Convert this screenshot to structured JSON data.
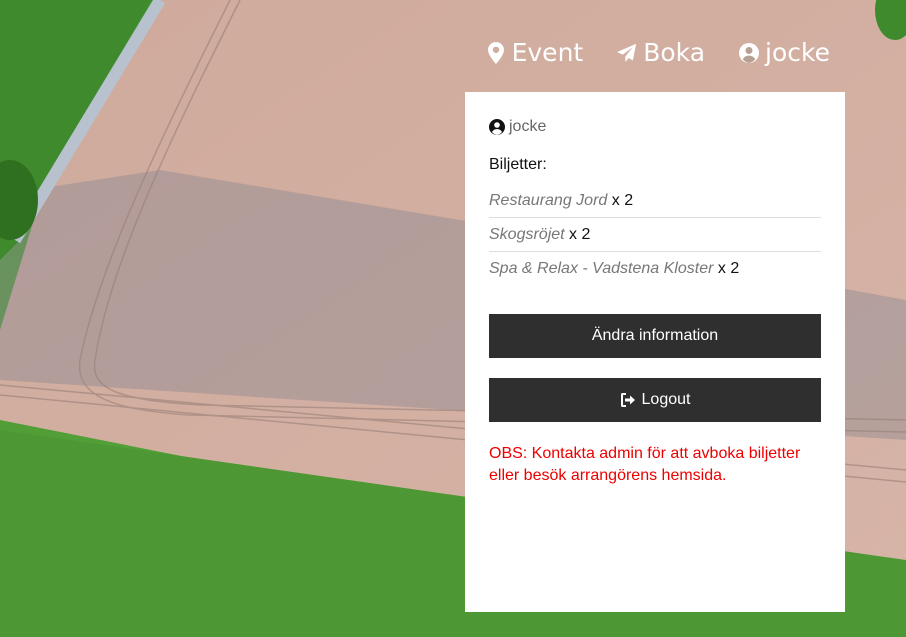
{
  "nav": {
    "event_label": "Event",
    "boka_label": "Boka",
    "user_label": "jocke"
  },
  "panel": {
    "username": "jocke",
    "tickets_heading": "Biljetter:",
    "tickets": [
      {
        "name": "Restaurang Jord",
        "qty": "x 2"
      },
      {
        "name": "Skogsröjet",
        "qty": "x 2"
      },
      {
        "name": "Spa & Relax - Vadstena Kloster",
        "qty": "x 2"
      }
    ],
    "edit_button": "Ändra information",
    "logout_button": "Logout",
    "notice": "OBS: Kontakta admin för att avboka biljetter eller besök arrangörens hemsida."
  },
  "colors": {
    "button_bg": "#2f2f2f",
    "notice_text": "#e00000",
    "field": "#c9a79a",
    "grass": "#4f9a35"
  },
  "icons": {
    "event": "map-marker-icon",
    "boka": "paper-plane-icon",
    "user": "user-circle-icon",
    "logout": "sign-out-icon"
  }
}
